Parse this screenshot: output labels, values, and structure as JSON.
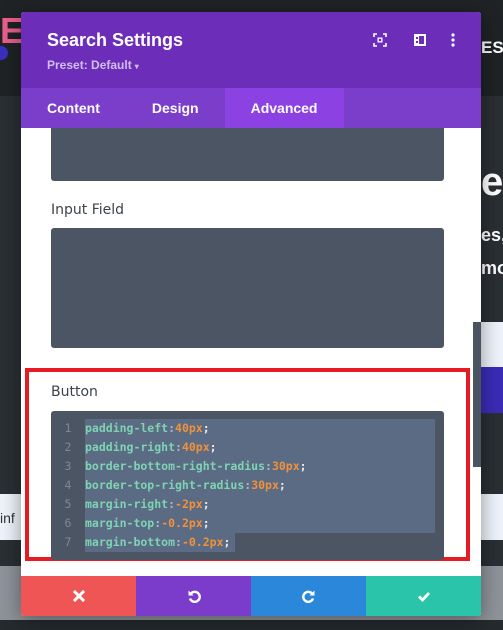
{
  "background": {
    "logo_fragment": "E",
    "nav_fragment": "ES",
    "heading_fragment": "e",
    "subtext_line1": "es,",
    "subtext_line2": "mo",
    "info_fragment": "inf"
  },
  "modal": {
    "title": "Search Settings",
    "preset_label": "Preset: Default",
    "preset_caret": "▾",
    "header_icons": [
      "fullscreen-icon",
      "split-view-icon",
      "more-options-icon"
    ],
    "tabs": [
      {
        "label": "Content",
        "active": false
      },
      {
        "label": "Design",
        "active": false
      },
      {
        "label": "Advanced",
        "active": true
      }
    ],
    "sections": {
      "input_field_label": "Input Field",
      "input_field_css": "",
      "button_label": "Button"
    },
    "button_css": [
      {
        "n": "1",
        "prop": "padding-left",
        "val": "40px"
      },
      {
        "n": "2",
        "prop": "padding-right",
        "val": "40px"
      },
      {
        "n": "3",
        "prop": "border-bottom-right-radius",
        "val": "30px"
      },
      {
        "n": "4",
        "prop": "border-top-right-radius",
        "val": "30px"
      },
      {
        "n": "5",
        "prop": "margin-right",
        "val": "-2px"
      },
      {
        "n": "6",
        "prop": "margin-top",
        "val": "-0.2px"
      },
      {
        "n": "7",
        "prop": "margin-bottom",
        "val": "-0.2px"
      }
    ],
    "footer": {
      "cancel": "cancel-icon",
      "undo": "undo-icon",
      "redo": "redo-icon",
      "save": "save-check-icon"
    },
    "colors": {
      "header": "#6c2eb9",
      "tabs": "#7b3ecb",
      "active_tab": "#8c42e3",
      "cancel": "#ef5555",
      "undo": "#7c3ccb",
      "redo": "#2b87da",
      "save": "#29c4a9",
      "highlight": "#e41b23"
    }
  }
}
